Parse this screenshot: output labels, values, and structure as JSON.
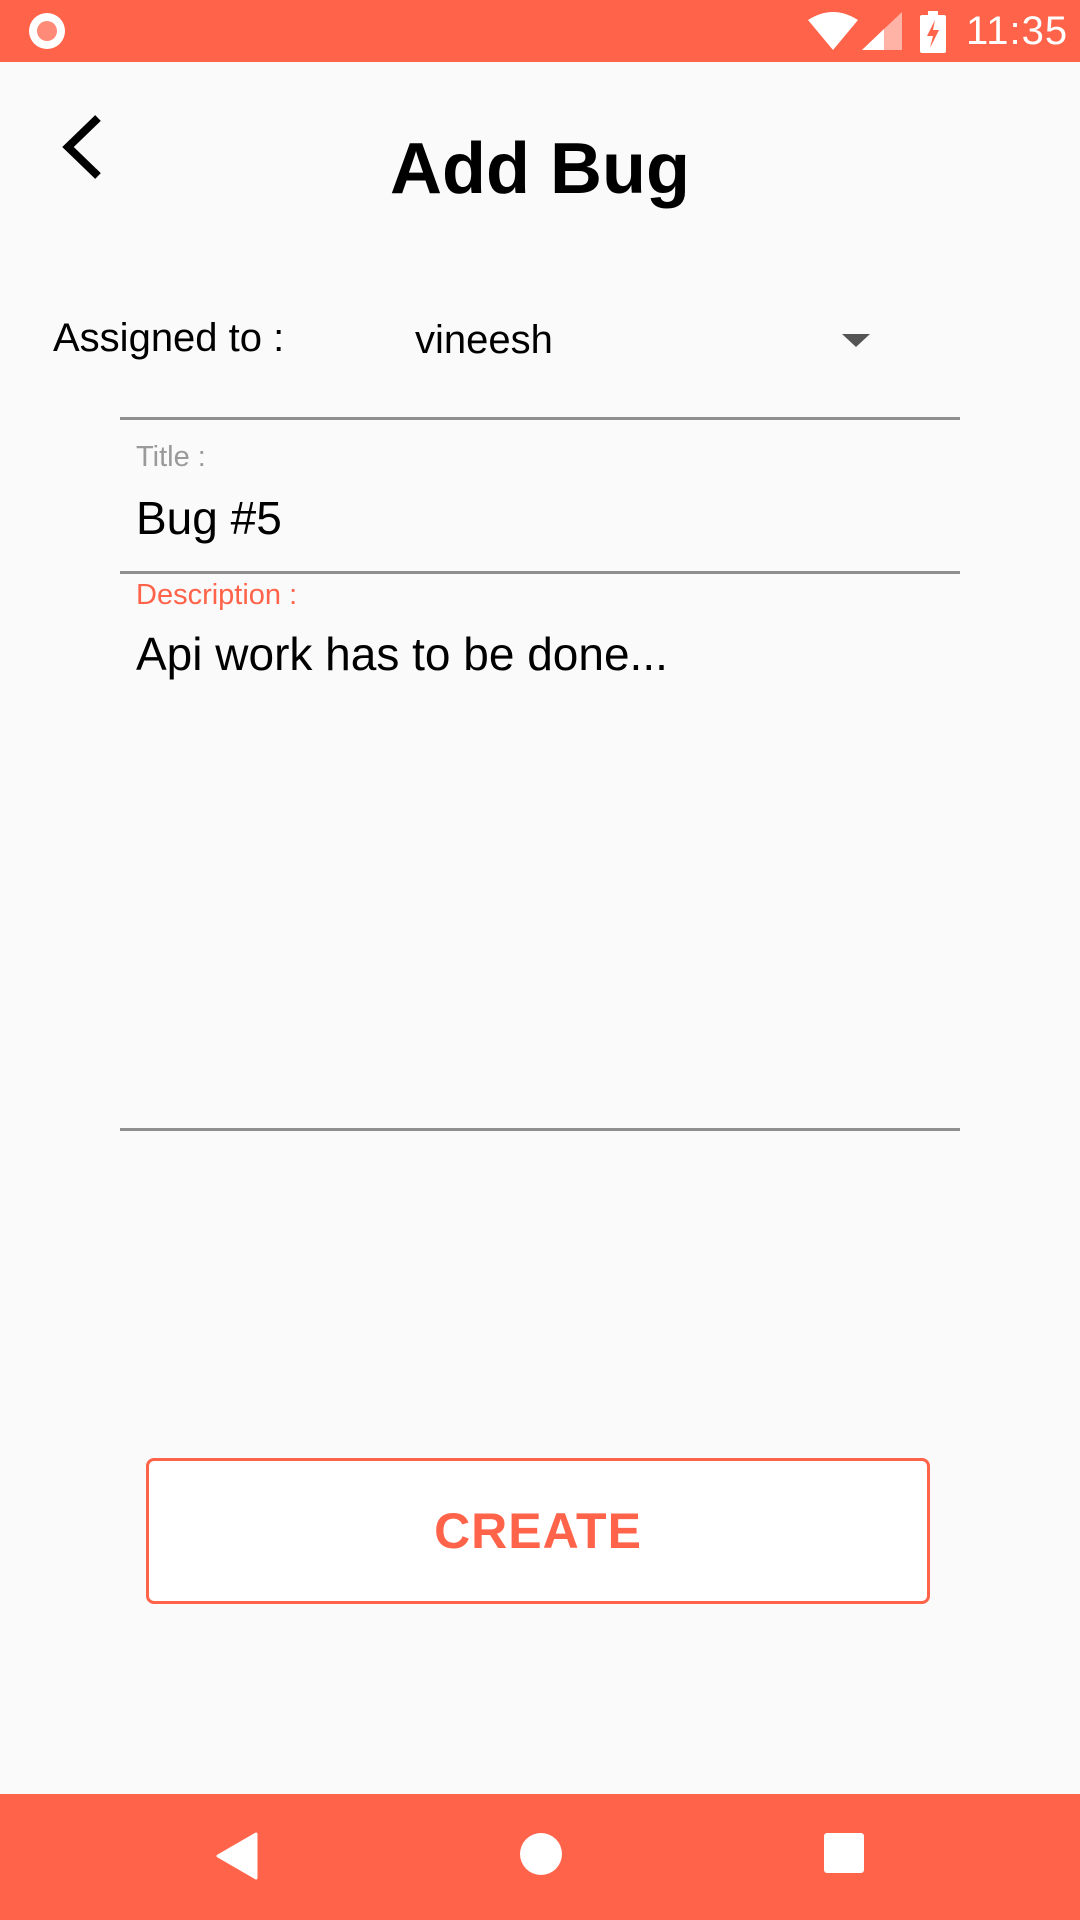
{
  "status_bar": {
    "time": "11:35",
    "icons": [
      "record-icon",
      "wifi-icon",
      "signal-icon",
      "battery-charging-icon"
    ]
  },
  "header": {
    "title": "Add Bug",
    "back_icon": "chevron-left-icon"
  },
  "form": {
    "assigned_label": "Assigned to :",
    "assigned_value": "vineesh",
    "title_label": "Title :",
    "title_value": "Bug #5",
    "description_label": "Description :",
    "description_value": "Api work has to be done..."
  },
  "actions": {
    "create_label": "CREATE"
  },
  "nav_bar": {
    "icons": [
      "back-triangle-icon",
      "home-circle-icon",
      "recents-square-icon"
    ]
  },
  "colors": {
    "accent": "#ff634a",
    "background": "#fafafa",
    "label_inactive": "#9a9a9a",
    "divider": "#8e8e8e"
  }
}
